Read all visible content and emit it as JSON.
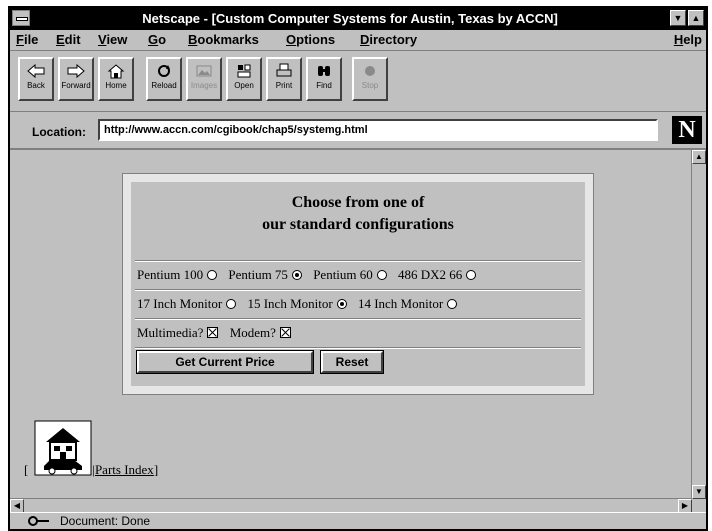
{
  "window": {
    "title": "Netscape - [Custom Computer Systems for Austin, Texas by ACCN]"
  },
  "menu": {
    "items": [
      {
        "label": "File",
        "u": "F",
        "rest": "ile"
      },
      {
        "label": "Edit",
        "u": "E",
        "rest": "dit"
      },
      {
        "label": "View",
        "u": "V",
        "rest": "iew"
      },
      {
        "label": "Go",
        "u": "G",
        "rest": "o"
      },
      {
        "label": "Bookmarks",
        "u": "B",
        "rest": "ookmarks"
      },
      {
        "label": "Options",
        "u": "O",
        "rest": "ptions"
      },
      {
        "label": "Directory",
        "u": "D",
        "rest": "irectory"
      },
      {
        "label": "Help",
        "u": "H",
        "rest": "elp"
      }
    ]
  },
  "toolbar": {
    "buttons": [
      {
        "label": "Back",
        "icon": "back-arrow-icon",
        "enabled": true
      },
      {
        "label": "Forward",
        "icon": "forward-arrow-icon",
        "enabled": true
      },
      {
        "label": "Home",
        "icon": "home-icon",
        "enabled": true
      },
      {
        "label": "Reload",
        "icon": "reload-icon",
        "enabled": true
      },
      {
        "label": "Images",
        "icon": "images-icon",
        "enabled": false
      },
      {
        "label": "Open",
        "icon": "open-icon",
        "enabled": true
      },
      {
        "label": "Print",
        "icon": "print-icon",
        "enabled": true
      },
      {
        "label": "Find",
        "icon": "find-icon",
        "enabled": true
      },
      {
        "label": "Stop",
        "icon": "stop-icon",
        "enabled": false
      }
    ]
  },
  "location": {
    "label": "Location:",
    "url": "http://www.accn.com/cgibook/chap5/systemg.html",
    "logo": "N"
  },
  "form": {
    "heading_line1": "Choose from one of",
    "heading_line2": "our standard configurations",
    "cpu_options": [
      {
        "label": "Pentium 100",
        "selected": false
      },
      {
        "label": "Pentium 75",
        "selected": true
      },
      {
        "label": "Pentium 60",
        "selected": false
      },
      {
        "label": "486 DX2 66",
        "selected": false
      }
    ],
    "monitor_options": [
      {
        "label": "17 Inch Monitor",
        "selected": false
      },
      {
        "label": "15 Inch Monitor",
        "selected": true
      },
      {
        "label": "14 Inch Monitor",
        "selected": false
      }
    ],
    "extras": [
      {
        "label": "Multimedia?",
        "checked": true
      },
      {
        "label": "Modem?",
        "checked": true
      }
    ],
    "submit_label": "Get Current Price",
    "reset_label": "Reset"
  },
  "links": {
    "parts_index": "Parts Index"
  },
  "status": {
    "text": "Document: Done"
  }
}
